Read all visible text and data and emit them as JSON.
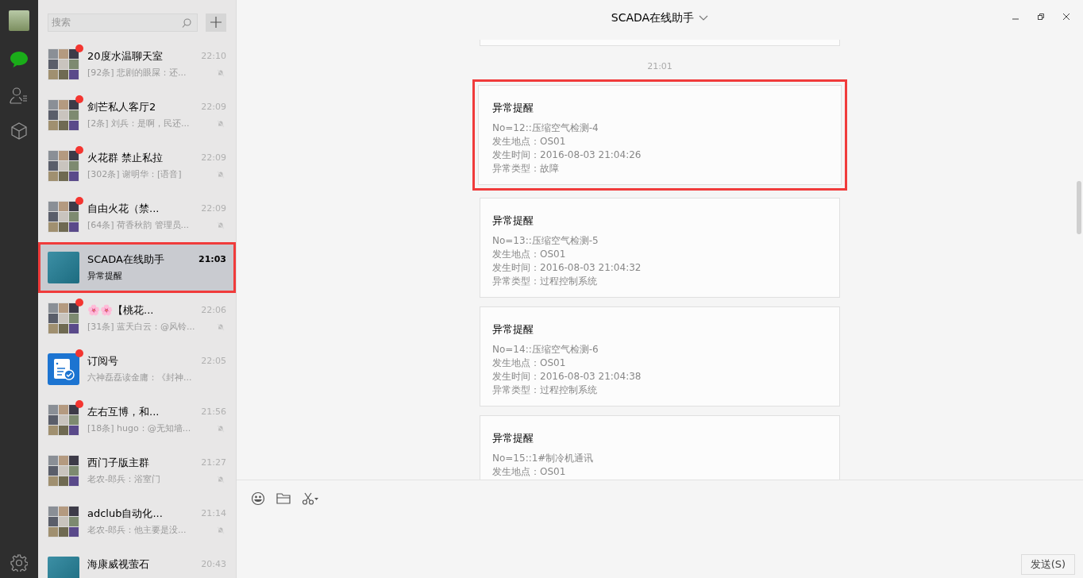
{
  "search": {
    "placeholder": "搜索"
  },
  "chats": [
    {
      "name": "20度水温聊天室",
      "time": "22:10",
      "preview": "[92条] 悲剧的眼屎：还...",
      "kind": "group",
      "unread": true,
      "muted": true,
      "selected": false,
      "highlighted": false
    },
    {
      "name": "剑芒私人客厅2",
      "time": "22:09",
      "preview": "[2条] 刘兵：是啊，民还...",
      "kind": "group",
      "unread": true,
      "muted": true,
      "selected": false,
      "highlighted": false
    },
    {
      "name": "火花群 禁止私拉",
      "time": "22:09",
      "preview": "[302条] 谢明华：[语音]",
      "kind": "group",
      "unread": true,
      "muted": true,
      "selected": false,
      "highlighted": false
    },
    {
      "name": "自由火花（禁...",
      "time": "22:09",
      "preview": "[64条] 荷香秋韵 管理员...",
      "kind": "group",
      "unread": true,
      "muted": true,
      "selected": false,
      "highlighted": false
    },
    {
      "name": "SCADA在线助手",
      "time": "21:03",
      "preview": "异常提醒",
      "kind": "logo",
      "unread": false,
      "muted": false,
      "selected": true,
      "highlighted": true
    },
    {
      "name": "🌸🌸【桃花...",
      "time": "22:06",
      "preview": "[31条] 蓝天白云：@风铃...",
      "kind": "group",
      "unread": true,
      "muted": true,
      "selected": false,
      "highlighted": false
    },
    {
      "name": "订阅号",
      "time": "22:05",
      "preview": "六神磊磊读金庸：《封神...",
      "kind": "subscription",
      "unread": true,
      "muted": false,
      "selected": false,
      "highlighted": false
    },
    {
      "name": "左右互博，和...",
      "time": "21:56",
      "preview": "[18条] hugo：@无知墙...",
      "kind": "group",
      "unread": true,
      "muted": true,
      "selected": false,
      "highlighted": false
    },
    {
      "name": "西门子版主群",
      "time": "21:27",
      "preview": "老农-郎兵：浴室门",
      "kind": "group",
      "unread": false,
      "muted": true,
      "selected": false,
      "highlighted": false
    },
    {
      "name": "adclub自动化...",
      "time": "21:14",
      "preview": "老农-郎兵：他主要是没...",
      "kind": "group",
      "unread": false,
      "muted": true,
      "selected": false,
      "highlighted": false
    },
    {
      "name": "海康威视萤石",
      "time": "20:43",
      "kind": "logo",
      "unread": false,
      "muted": false,
      "selected": false,
      "highlighted": false
    }
  ],
  "conversation": {
    "title": "SCADA在线助手",
    "timestamp": "21:01",
    "messages": [
      {
        "title": "异常提醒",
        "lines": [
          "No=12::压缩空气检测-4",
          "发生地点：OS01",
          "发生时间：2016-08-03 21:04:26",
          "异常类型：故障"
        ],
        "highlighted": true
      },
      {
        "title": "异常提醒",
        "lines": [
          "No=13::压缩空气检测-5",
          "发生地点：OS01",
          "发生时间：2016-08-03 21:04:32",
          "异常类型：过程控制系统"
        ],
        "highlighted": false
      },
      {
        "title": "异常提醒",
        "lines": [
          "No=14::压缩空气检测-6",
          "发生地点：OS01",
          "发生时间：2016-08-03 21:04:38",
          "异常类型：过程控制系统"
        ],
        "highlighted": false
      },
      {
        "title": "异常提醒",
        "lines": [
          "No=15::1#制冷机通讯",
          "发生地点：OS01"
        ],
        "highlighted": false
      }
    ]
  },
  "send_button": "发送(S)"
}
